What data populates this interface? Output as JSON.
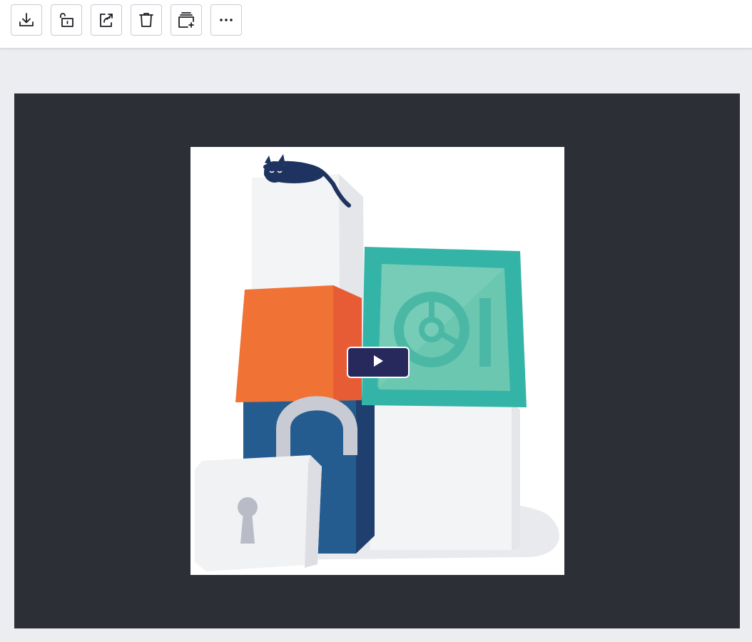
{
  "colors": {
    "page_bg": "#ecedf0",
    "toolbar_bg": "#ffffff",
    "viewer_bg": "#2d2f37",
    "play_button_bg": "#27285c",
    "icon_color": "#1e1f24"
  },
  "toolbar": {
    "buttons": [
      {
        "icon": "download-icon"
      },
      {
        "icon": "unlock-icon"
      },
      {
        "icon": "share-icon"
      },
      {
        "icon": "trash-icon"
      },
      {
        "icon": "add-to-collection-icon"
      },
      {
        "icon": "more-icon"
      }
    ]
  },
  "viewer": {
    "media": {
      "kind": "video-thumbnail",
      "illustration": "cat-on-blocks-padlock-safe",
      "play_icon": "play-icon"
    }
  }
}
